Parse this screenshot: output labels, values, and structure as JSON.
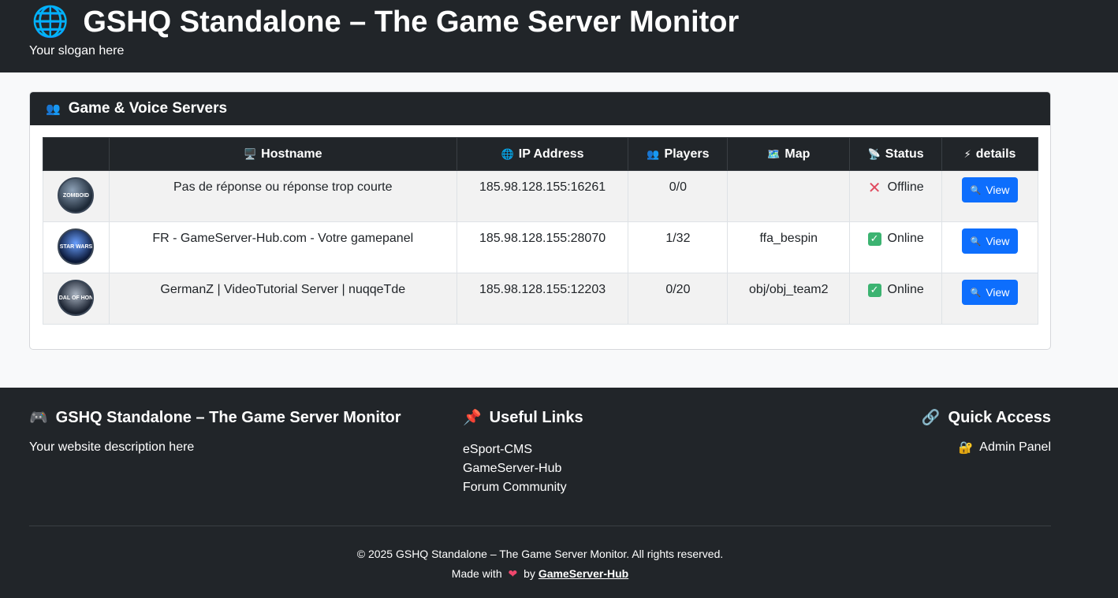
{
  "header": {
    "title": "GSHQ Standalone – The Game Server Monitor",
    "slogan": "Your slogan here",
    "icon": "globe-icon"
  },
  "servers_card": {
    "title": "Game & Voice Servers",
    "icon": "users-icon",
    "columns": {
      "hostname": "Hostname",
      "ip": "IP Address",
      "players": "Players",
      "map": "Map",
      "status": "Status",
      "details": "details"
    },
    "rows": [
      {
        "game": "ZOMBOID",
        "hostname": "Pas de réponse ou réponse trop courte",
        "ip": "185.98.128.155:16261",
        "players": "0/0",
        "map": "",
        "status": "Offline",
        "online": false,
        "button": "View"
      },
      {
        "game": "STAR WARS",
        "hostname": "FR - GameServer-Hub.com - Votre gamepanel",
        "ip": "185.98.128.155:28070",
        "players": "1/32",
        "map": "ffa_bespin",
        "status": "Online",
        "online": true,
        "button": "View"
      },
      {
        "game": "MEDAL OF HONOR",
        "hostname": "GermanZ | VideoTutorial Server | nuqqeTde",
        "ip": "185.98.128.155:12203",
        "players": "0/20",
        "map": "obj/obj_team2",
        "status": "Online",
        "online": true,
        "button": "View"
      }
    ]
  },
  "footer": {
    "about_title": "GSHQ Standalone – The Game Server Monitor",
    "about_text": "Your website description here",
    "links_title": "Useful Links",
    "links": [
      "eSport-CMS",
      "GameServer-Hub",
      "Forum Community"
    ],
    "quick_title": "Quick Access",
    "admin_label": "Admin Panel",
    "copyright": "© 2025 GSHQ Standalone – The Game Server Monitor. All rights reserved.",
    "made_with": "Made with",
    "by": "by",
    "author": "GameServer-Hub"
  },
  "colors": {
    "dark": "#212529",
    "primary": "#0d6efd",
    "online": "#3cb371",
    "offline": "#e04a5f"
  }
}
